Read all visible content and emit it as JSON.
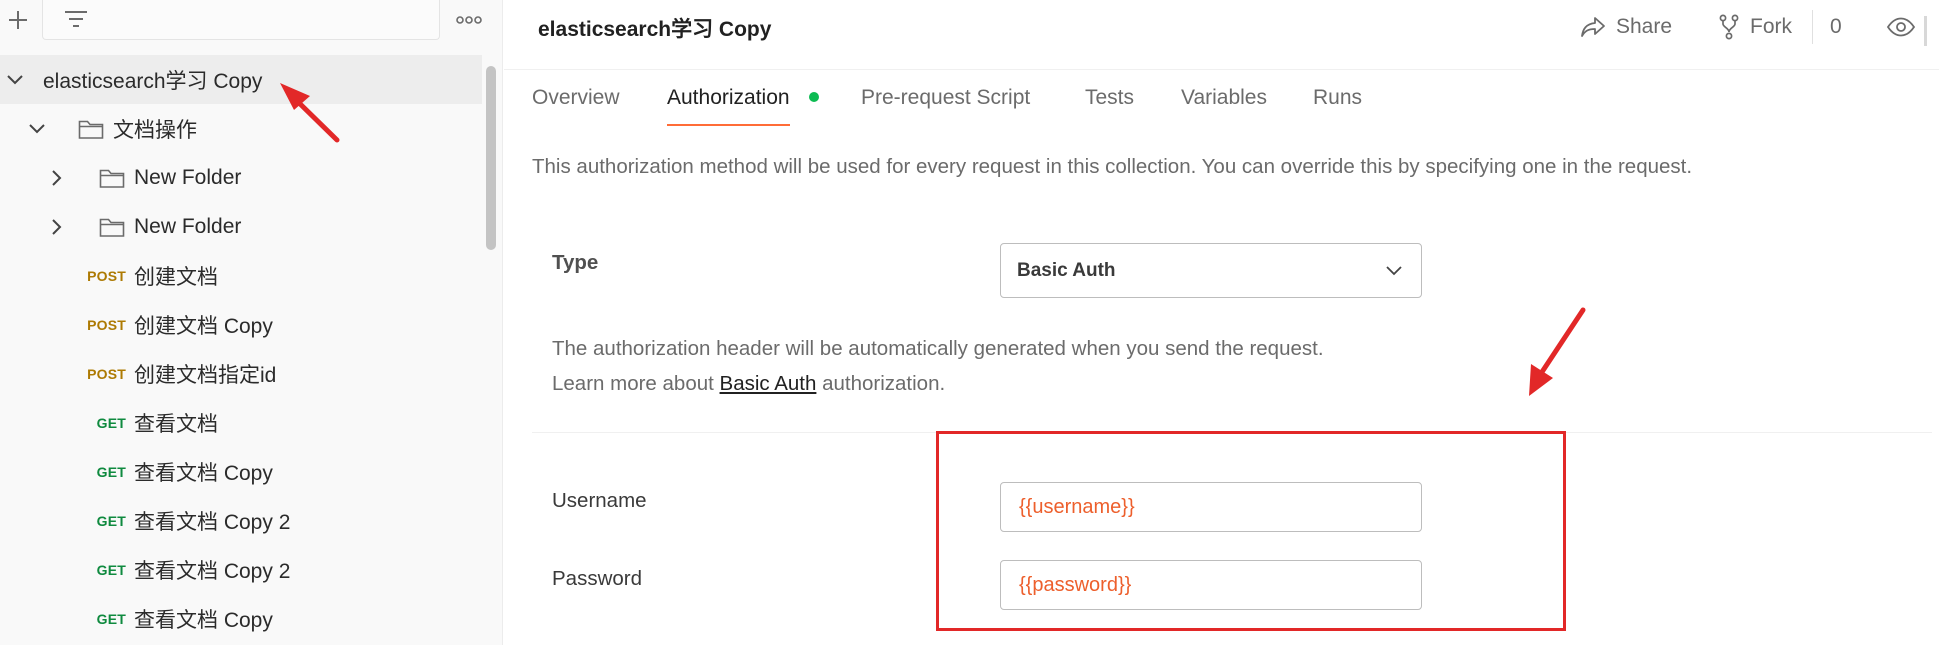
{
  "sidebar": {
    "tree": [
      {
        "kind": "collection",
        "label": "elasticsearch学习 Copy",
        "expanded": true,
        "selected": true
      },
      {
        "kind": "folder",
        "label": "文档操作",
        "expanded": true
      },
      {
        "kind": "folder",
        "label": "New Folder",
        "expanded": false
      },
      {
        "kind": "folder",
        "label": "New Folder",
        "expanded": false
      },
      {
        "kind": "request",
        "method": "POST",
        "label": "创建文档"
      },
      {
        "kind": "request",
        "method": "POST",
        "label": "创建文档 Copy"
      },
      {
        "kind": "request",
        "method": "POST",
        "label": "创建文档指定id"
      },
      {
        "kind": "request",
        "method": "GET",
        "label": "查看文档"
      },
      {
        "kind": "request",
        "method": "GET",
        "label": "查看文档 Copy"
      },
      {
        "kind": "request",
        "method": "GET",
        "label": "查看文档 Copy 2"
      },
      {
        "kind": "request",
        "method": "GET",
        "label": "查看文档 Copy 2"
      },
      {
        "kind": "request",
        "method": "GET",
        "label": "查看文档 Copy"
      }
    ]
  },
  "header": {
    "title": "elasticsearch学习 Copy",
    "share_label": "Share",
    "fork_label": "Fork",
    "fork_count": "0"
  },
  "tabs": [
    {
      "label": "Overview"
    },
    {
      "label": "Authorization"
    },
    {
      "label": "Pre-request Script"
    },
    {
      "label": "Tests"
    },
    {
      "label": "Variables"
    },
    {
      "label": "Runs"
    }
  ],
  "auth": {
    "info": "This authorization method will be used for every request in this collection. You can override this by specifying one in the request.",
    "type_label": "Type",
    "type_value": "Basic Auth",
    "desc_line1": "The authorization header will be automatically generated when you send the request.",
    "desc_prefix": "Learn more about ",
    "desc_link": "Basic Auth",
    "desc_suffix": " authorization.",
    "username_label": "Username",
    "username_value": "{{username}}",
    "password_label": "Password",
    "password_value": "{{password}}"
  },
  "colors": {
    "accent": "#ff6c37",
    "post": "#ad7a03",
    "get": "#0f8a3f",
    "variable": "#ed5f2c",
    "annotation": "#e22828",
    "status_dot": "#0cbb52"
  }
}
